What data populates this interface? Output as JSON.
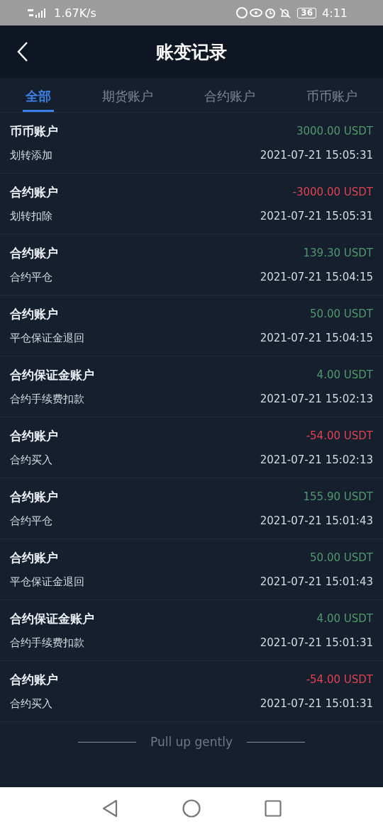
{
  "status_bar": {
    "network": "1.67K/s",
    "battery": "36",
    "time": "4:11"
  },
  "header": {
    "title": "账变记录"
  },
  "tabs": [
    {
      "label": "全部",
      "selected": true
    },
    {
      "label": "期货账户",
      "selected": false
    },
    {
      "label": "合约账户",
      "selected": false
    },
    {
      "label": "币币账户",
      "selected": false
    }
  ],
  "records": [
    {
      "account": "币币账户",
      "amount": "3000.00 USDT",
      "kind": "credit",
      "type": "划转添加",
      "time": "2021-07-21 15:05:31"
    },
    {
      "account": "合约账户",
      "amount": "-3000.00 USDT",
      "kind": "debit",
      "type": "划转扣除",
      "time": "2021-07-21 15:05:31"
    },
    {
      "account": "合约账户",
      "amount": "139.30 USDT",
      "kind": "credit",
      "type": "合约平仓",
      "time": "2021-07-21 15:04:15"
    },
    {
      "account": "合约账户",
      "amount": "50.00 USDT",
      "kind": "credit",
      "type": "平仓保证金退回",
      "time": "2021-07-21 15:04:15"
    },
    {
      "account": "合约保证金账户",
      "amount": "4.00 USDT",
      "kind": "credit",
      "type": "合约手续费扣款",
      "time": "2021-07-21 15:02:13"
    },
    {
      "account": "合约账户",
      "amount": "-54.00 USDT",
      "kind": "debit",
      "type": "合约买入",
      "time": "2021-07-21 15:02:13"
    },
    {
      "account": "合约账户",
      "amount": "155.90 USDT",
      "kind": "credit",
      "type": "合约平仓",
      "time": "2021-07-21 15:01:43"
    },
    {
      "account": "合约账户",
      "amount": "50.00 USDT",
      "kind": "credit",
      "type": "平仓保证金退回",
      "time": "2021-07-21 15:01:43"
    },
    {
      "account": "合约保证金账户",
      "amount": "4.00 USDT",
      "kind": "credit",
      "type": "合约手续费扣款",
      "time": "2021-07-21 15:01:31"
    },
    {
      "account": "合约账户",
      "amount": "-54.00 USDT",
      "kind": "debit",
      "type": "合约买入",
      "time": "2021-07-21 15:01:31"
    }
  ],
  "footer": {
    "hint": "Pull up gently"
  }
}
